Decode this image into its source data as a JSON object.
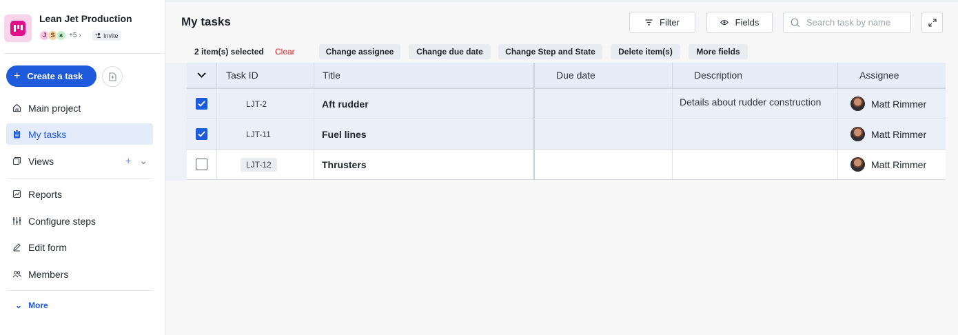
{
  "workspace": {
    "name": "Lean Jet Production",
    "members": [
      "J",
      "S",
      "a"
    ],
    "more_members": "+5",
    "invite_label": "Invite"
  },
  "sidebar": {
    "create_label": "Create a task",
    "items": [
      {
        "label": "Main project",
        "icon": "home-icon"
      },
      {
        "label": "My tasks",
        "icon": "clipboard-icon",
        "active": true
      },
      {
        "label": "Views",
        "icon": "views-icon"
      },
      {
        "label": "Reports",
        "icon": "chart-icon"
      },
      {
        "label": "Configure steps",
        "icon": "steps-icon"
      },
      {
        "label": "Edit form",
        "icon": "edit-icon"
      },
      {
        "label": "Members",
        "icon": "people-icon"
      }
    ],
    "more_label": "More"
  },
  "header": {
    "title": "My tasks",
    "filter_label": "Filter",
    "fields_label": "Fields",
    "search_placeholder": "Search task by name"
  },
  "selection": {
    "count_text": "2 item(s) selected",
    "clear_label": "Clear",
    "actions": [
      "Change assignee",
      "Change due date",
      "Change Step and State",
      "Delete item(s)",
      "More fields"
    ]
  },
  "table": {
    "columns": [
      "Task ID",
      "Title",
      "Due date",
      "Description",
      "Assignee"
    ],
    "rows": [
      {
        "selected": true,
        "id": "LJT-2",
        "title": "Aft rudder",
        "due": "",
        "description": "Details about rudder construction",
        "assignee": "Matt Rimmer"
      },
      {
        "selected": true,
        "id": "LJT-11",
        "title": "Fuel lines",
        "due": "",
        "description": "",
        "assignee": "Matt Rimmer"
      },
      {
        "selected": false,
        "id": "LJT-12",
        "title": "Thrusters",
        "due": "",
        "description": "",
        "assignee": "Matt Rimmer"
      }
    ]
  },
  "colors": {
    "accent": "#1e5bdc",
    "brand": "#e0108a",
    "danger": "#e02424"
  }
}
